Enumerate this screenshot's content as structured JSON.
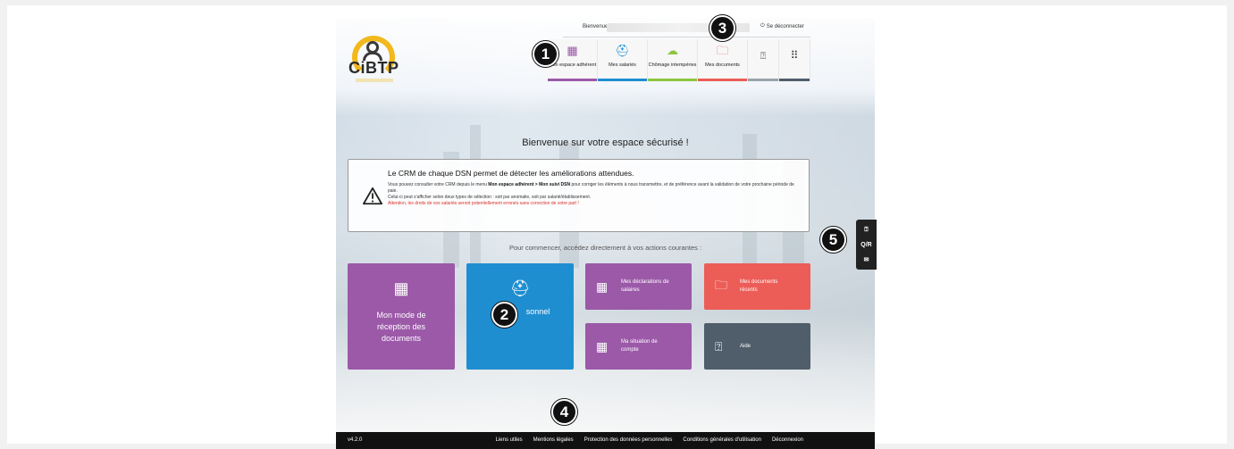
{
  "header": {
    "greeting": "Bienvenue J",
    "logout_label": "Se déconnecter",
    "logo_text": "CiBTP"
  },
  "nav": {
    "items": [
      {
        "label": "Mon espace adhérent",
        "icon": "building-icon",
        "color": "#9b59a8"
      },
      {
        "label": "Mes salariés",
        "icon": "helmet-icon",
        "color": "#1f8ed1"
      },
      {
        "label": "Chômage intempéries",
        "icon": "rain-cloud-icon",
        "color": "#8cc63f"
      },
      {
        "label": "Mes documents",
        "icon": "folder-icon",
        "color": "#ec5d57"
      },
      {
        "label": "",
        "icon": "help-icon",
        "color": "#9aa3ab"
      },
      {
        "label": "",
        "icon": "apps-grid-icon",
        "color": "#505e6b"
      }
    ]
  },
  "main": {
    "title": "Bienvenue sur votre espace sécurisé !",
    "alert": {
      "title": "Le CRM de chaque DSN permet de détecter les améliorations attendues.",
      "line1_a": "Vous pouvez consulter votre CRM depuis le menu ",
      "line1_b": "Mon espace adhérent > Mon suivi DSN",
      "line1_c": " pour corriger les éléments à nous transmettre, et de préférence avant la validation de votre prochaine période de paie.",
      "line2": "Celui-ci peut s'afficher selon deux types de sélection : soit par anomalie, soit par salarié/établissement.",
      "warning": "Attention, les droits de vos salariés seront potentiellement erronés sans correction de votre part !"
    },
    "subtitle": "Pour commencer, accédez directement à vos actions courantes :",
    "tiles": {
      "reception": "Mon mode de réception des documents",
      "personnel": "sonnel",
      "declarations": "Mes déclarations de salaires",
      "documents": "Mes documents récents",
      "situation": "Ma situation de compte",
      "aide": "Aide"
    }
  },
  "side": {
    "qr_label": "Q/R"
  },
  "markers": [
    "1",
    "2",
    "3",
    "4",
    "5"
  ],
  "footer": {
    "version": "v4.2.0",
    "links": [
      "Liens utiles",
      "Mentions légales",
      "Protection des données personnelles",
      "Conditions générales d'utilisation",
      "Déconnexion"
    ]
  }
}
